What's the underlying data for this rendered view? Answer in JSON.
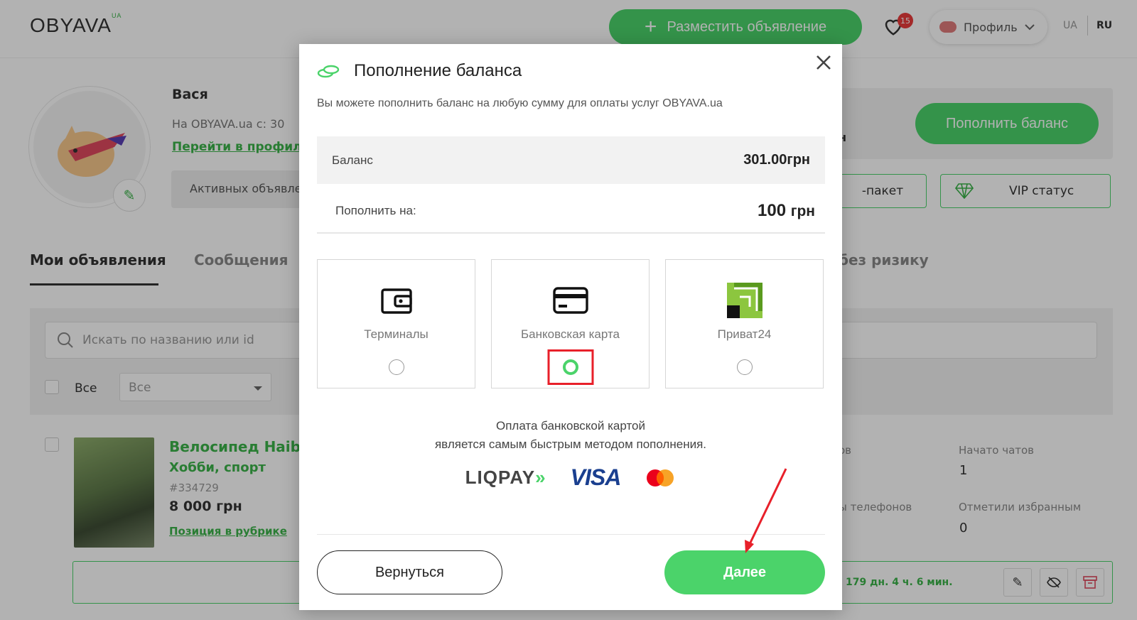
{
  "header": {
    "logo_text": "OBYAVA",
    "logo_suffix": "UA",
    "post_ad_label": "Разместить объявление",
    "favorites_count": "15",
    "profile_label": "Профиль",
    "lang_ua": "UA",
    "lang_ru": "RU"
  },
  "profile": {
    "name": "Вася",
    "since": "На OBYAVA.ua с: 30",
    "profile_link": "Перейти в профиль",
    "active_ads_label": "Активных объявлений",
    "balance_suffix": "н",
    "topup_button": "Пополнить баланс",
    "package_label": "-пакет",
    "vip_label": "VIP статус"
  },
  "tabs": {
    "my_ads": "Мои объявления",
    "messages": "Сообщения",
    "no_risk": "без ризику"
  },
  "filters": {
    "search_placeholder": "Искать по названию или id",
    "select_all_label": "Все",
    "filter_value": "Все"
  },
  "ad": {
    "title": "Велосипед Haibik",
    "category": "Хобби, спорт",
    "id": "#334729",
    "price": "8 000 грн",
    "position_link": "Позиция в рубрике",
    "timer": "179 дн. 4 ч. 6 мин.",
    "stats": {
      "views_label": "ов",
      "chats_label": "Начато чатов",
      "chats_value": "1",
      "phones_label": "ы телефонов",
      "favorites_label": "Отметили избранным",
      "favorites_value": "0"
    }
  },
  "modal": {
    "title": "Пополнение баланса",
    "subtitle": "Вы можете пополнить баланс на любую сумму для оплаты услуг OBYAVA.ua",
    "balance_label": "Баланс",
    "balance_value": "301.00грн",
    "topup_label": "Пополнить на:",
    "topup_amount": "100",
    "topup_unit": "грн",
    "payment_methods": [
      {
        "label": "Терминалы",
        "icon": "wallet-icon",
        "selected": false
      },
      {
        "label": "Банковская карта",
        "icon": "credit-card-icon",
        "selected": true
      },
      {
        "label": "Приват24",
        "icon": "privat24-logo",
        "selected": false
      }
    ],
    "note_line1": "Оплата банковской картой",
    "note_line2": "является самым быстрым методом пополнения.",
    "logos": {
      "liqpay": "LIQPAY",
      "visa": "VISA",
      "mastercard": "mastercard-logo"
    },
    "back_button": "Вернуться",
    "next_button": "Далее"
  },
  "colors": {
    "accent_green": "#4bd36a",
    "link_green": "#3bb34a",
    "annotation_red": "#e8202a",
    "badge_red": "#ea3b3b",
    "overlay": "rgba(0,0,0,0.30)"
  }
}
